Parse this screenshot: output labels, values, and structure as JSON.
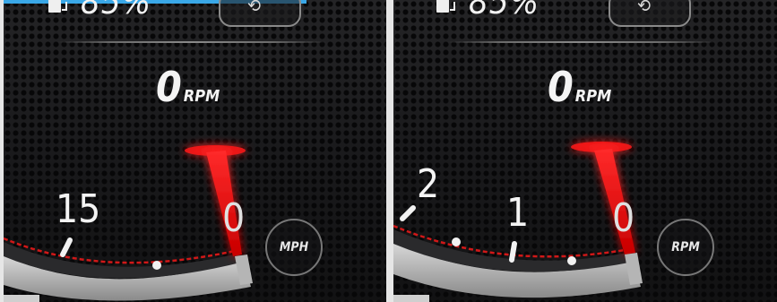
{
  "left_panel": {
    "fuel_text": "85%",
    "rpm_value": "0",
    "rpm_unit": "RPM",
    "tick_labels": [
      "15",
      "0"
    ],
    "unit_button": "MPH"
  },
  "right_panel": {
    "fuel_text": "85%",
    "rpm_value": "0",
    "rpm_unit": "RPM",
    "tick_labels": [
      "2",
      "1",
      "0"
    ],
    "unit_button": "RPM"
  },
  "icons": {
    "fuel": "fuel-pump-icon",
    "mode": "route-icon"
  },
  "colors": {
    "needle": "#ff1a1a",
    "accent_strip": "#3aa8e8",
    "red_track": "#d01818"
  }
}
